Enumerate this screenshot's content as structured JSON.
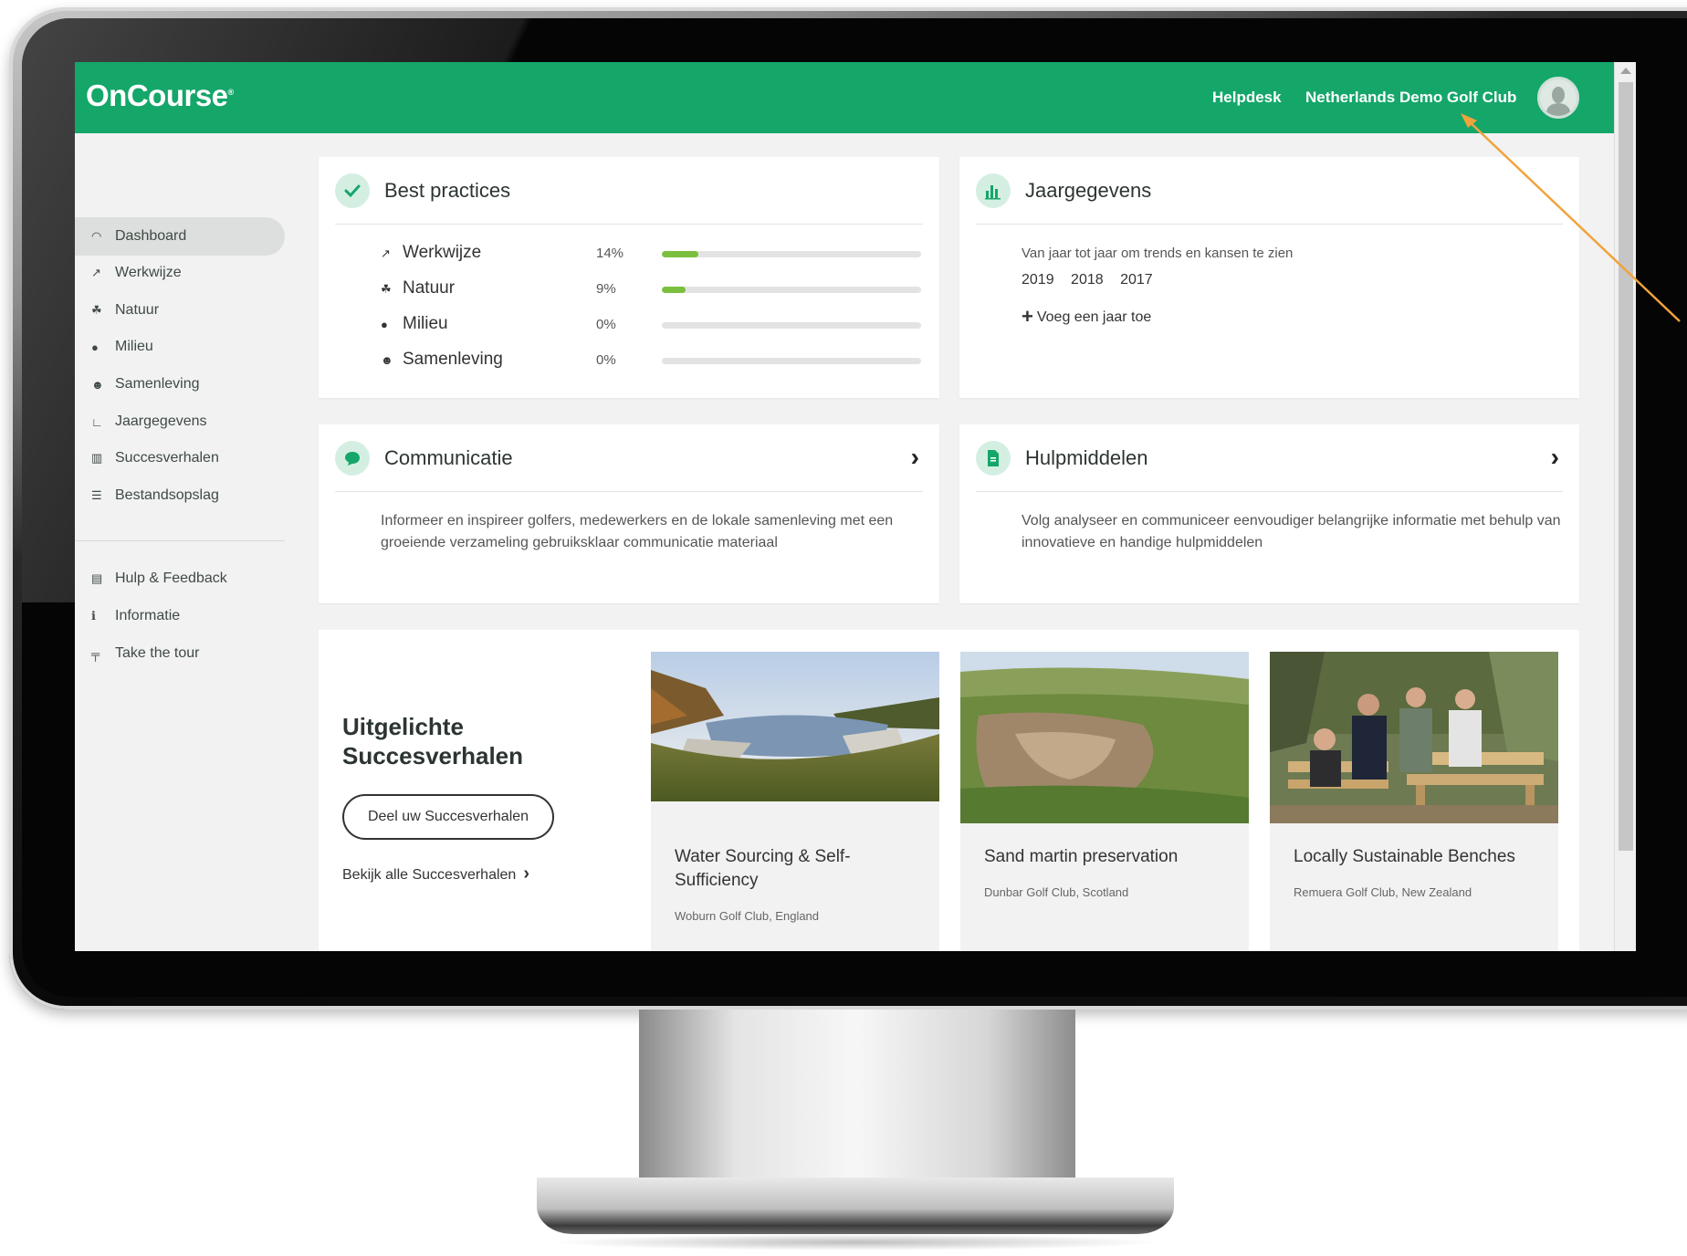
{
  "header": {
    "logo": "OnCourse",
    "logo_mark": "®",
    "helpdesk": "Helpdesk",
    "club": "Netherlands Demo Golf Club"
  },
  "sidebar": {
    "items": [
      {
        "label": "Dashboard",
        "icon": "speedometer-icon",
        "active": true
      },
      {
        "label": "Werkwijze",
        "icon": "golf-flag-icon"
      },
      {
        "label": "Natuur",
        "icon": "leaf-icon"
      },
      {
        "label": "Milieu",
        "icon": "water-drop-icon"
      },
      {
        "label": "Samenleving",
        "icon": "people-icon"
      },
      {
        "label": "Jaargegevens",
        "icon": "chart-icon"
      },
      {
        "label": "Succesverhalen",
        "icon": "book-icon"
      },
      {
        "label": "Bestandsopslag",
        "icon": "database-icon"
      }
    ],
    "secondary": [
      {
        "label": "Hulp & Feedback",
        "icon": "comment-icon"
      },
      {
        "label": "Informatie",
        "icon": "info-icon"
      },
      {
        "label": "Take the tour",
        "icon": "signpost-icon"
      }
    ]
  },
  "best_practices": {
    "title": "Best practices",
    "rows": [
      {
        "label": "Werkwijze",
        "pct": "14%",
        "fill": 0.14
      },
      {
        "label": "Natuur",
        "pct": "9%",
        "fill": 0.09
      },
      {
        "label": "Milieu",
        "pct": "0%",
        "fill": 0
      },
      {
        "label": "Samenleving",
        "pct": "0%",
        "fill": 0
      }
    ]
  },
  "jaargegevens": {
    "title": "Jaargegevens",
    "text": "Van jaar tot jaar om trends en kansen te zien",
    "years": [
      "2019",
      "2018",
      "2017"
    ],
    "add": "Voeg een jaar toe"
  },
  "communicatie": {
    "title": "Communicatie",
    "text": "Informeer en inspireer golfers, medewerkers en de lokale samenleving met een groeiende verzameling gebruiksklaar communicatie materiaal"
  },
  "hulpmiddelen": {
    "title": "Hulpmiddelen",
    "text": "Volg analyseer en communiceer eenvoudiger belangrijke informatie met behulp van innovatieve en handige hulpmiddelen"
  },
  "stories": {
    "title": "Uitgelichte Succesverhalen",
    "share": "Deel uw Succesverhalen",
    "see_all": "Bekijk alle Succesverhalen",
    "items": [
      {
        "title": "Water Sourcing & Self-Sufficiency",
        "sub": "Woburn Golf Club, England"
      },
      {
        "title": "Sand martin preservation",
        "sub": "Dunbar Golf Club, Scotland"
      },
      {
        "title": "Locally Sustainable Benches",
        "sub": "Remuera Golf Club, New Zealand"
      }
    ]
  },
  "colors": {
    "brand": "#15a66a",
    "progress": "#7bbf3f",
    "annotation": "#f0a33c"
  }
}
